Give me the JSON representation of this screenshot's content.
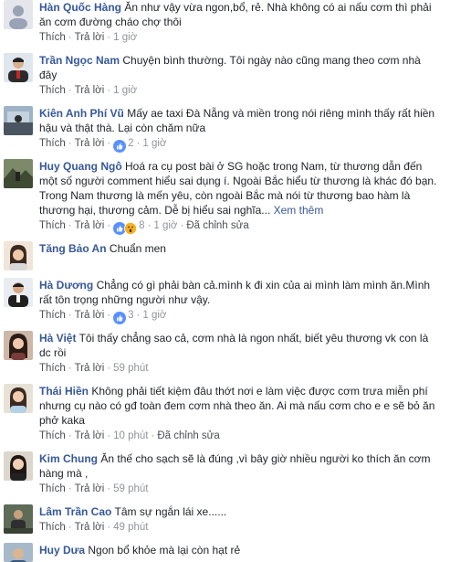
{
  "labels": {
    "like": "Thích",
    "reply": "Trả lời",
    "edited": "Đã chỉnh sửa",
    "see_more": "Xem thêm"
  },
  "comments": [
    {
      "name": "Hàn Quốc Hàng",
      "text": "Ăn như vậy vừa ngon,bổ, rẻ. Nhà không có ai nấu cơm thì phải ăn cơm đường cháo chợ thôi",
      "time": "1 giờ"
    },
    {
      "name": "Trần Ngọc Nam",
      "text": "Chuyện bình thường. Tôi ngày nào cũng mang theo cơm nhà đây",
      "time": "1 giờ"
    },
    {
      "name": "Kiên Anh Phí Vũ",
      "text": "Mấy ae taxi Đà Nẵng và miền trong nói riêng mình thấy rất hiền hậu và thật thà. Lại còn chăm nữa",
      "time": "1 giờ",
      "reactions": "2"
    },
    {
      "name": "Huy Quang Ngô",
      "text": "Hoá ra cụ post bài ở SG hoặc trong Nam, từ thương dẫn đến một số người comment hiểu sai dụng í. Ngoài Bắc hiểu từ thương là khác đó bạn. Trong Nam thương là mến yêu, còn ngoài Bắc mà nói từ thương bao hàm là thương hại, thương cảm. Dễ bị hiểu sai nghĩa...",
      "see_more": true,
      "time": "1 giờ",
      "reactions": "8",
      "edited": true
    },
    {
      "name": "Tăng Bảo An",
      "text": "Chuẩn men",
      "no_meta": true
    },
    {
      "name": "Hà Dương",
      "text": "Chẳng có gì phải bàn cả.mình k đi xin của ai mình làm mình ăn.Mình rất tôn trọng những người như vậy.",
      "time": "1 giờ",
      "reactions": "3"
    },
    {
      "name": "Hà Việt",
      "text": "Tôi thấy chẳng sao cả, cơm nhà là ngon nhất, biết yêu thương vk con là dc rồi",
      "time": "59 phút"
    },
    {
      "name": "Thái Hiền",
      "text": "Không phải tiết kiệm đâu thớt nơi e làm việc được cơm trưa miễn phí nhưng cụ nào có gđ toàn đem cơm nhà theo ăn. Ai mà nấu cơm cho e e sẽ bỏ ăn phở kaka",
      "time": "10 phút",
      "edited": true
    },
    {
      "name": "Kim Chung",
      "text": "Ăn thế cho sạch sẽ là đúng ,vì bây giờ nhiều người ko thích ăn cơm hàng mà ,",
      "time": "59 phút"
    },
    {
      "name": "Lâm Trần Cao",
      "text": "Tâm sự ngắn lái xe......",
      "time": "49 phút"
    },
    {
      "name": "Huy Dưa",
      "text": "Ngon bổ khỏe mà lại còn hạt rẻ",
      "no_meta": true
    }
  ],
  "colors": {
    "name": "#365899",
    "text": "#1d2129",
    "meta": "#90949c",
    "like_blue": "#5890ff",
    "haha_yellow": "#f7b125"
  }
}
